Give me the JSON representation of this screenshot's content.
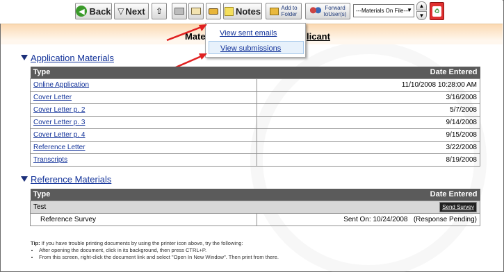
{
  "toolbar": {
    "back_label": "Back",
    "next_label": "Next",
    "notes_label": "Notes",
    "add_to_folder_line1": "Add to",
    "add_to_folder_line2": "Folder",
    "forward_line1": "Forward",
    "forward_line2": "toUser(s)",
    "select_value": "---Materials On File---"
  },
  "header": {
    "title_left": "Mater",
    "title_right": "licant"
  },
  "dropdown": {
    "items": [
      "View sent emails",
      "View submissions"
    ]
  },
  "application": {
    "title": "Application Materials",
    "col_type": "Type",
    "col_date": "Date Entered",
    "rows": [
      {
        "type": "Online Application",
        "date": "11/10/2008 10:28:00 AM"
      },
      {
        "type": "Cover Letter",
        "date": "3/16/2008"
      },
      {
        "type": "Cover Letter p. 2",
        "date": "5/7/2008"
      },
      {
        "type": "Cover Letter p. 3",
        "date": "9/14/2008"
      },
      {
        "type": "Cover Letter p. 4",
        "date": "9/15/2008"
      },
      {
        "type": "Reference Letter",
        "date": "3/22/2008"
      },
      {
        "type": "Transcripts",
        "date": "8/19/2008"
      }
    ]
  },
  "reference": {
    "title": "Reference Materials",
    "col_type": "Type",
    "col_date": "Date Entered",
    "group_name": "Test",
    "send_survey": "Send Survey",
    "survey_name": "Reference Survey",
    "survey_status": "Sent On: 10/24/2008   (Response Pending)"
  },
  "tips": {
    "lead_bold": "Tip:",
    "lead": " If you have trouble printing documents by using the printer icon above, try the following:",
    "items": [
      "After opening the document, click in its background, then press CTRL+P.",
      "From this screen, right-click the document link and select \"Open In New Window\". Then print from there."
    ]
  },
  "colors": {
    "accent_link": "#13339a",
    "header_band": "#fbd9b2",
    "table_header": "#5b5b5b",
    "arrow": "#e02020"
  }
}
